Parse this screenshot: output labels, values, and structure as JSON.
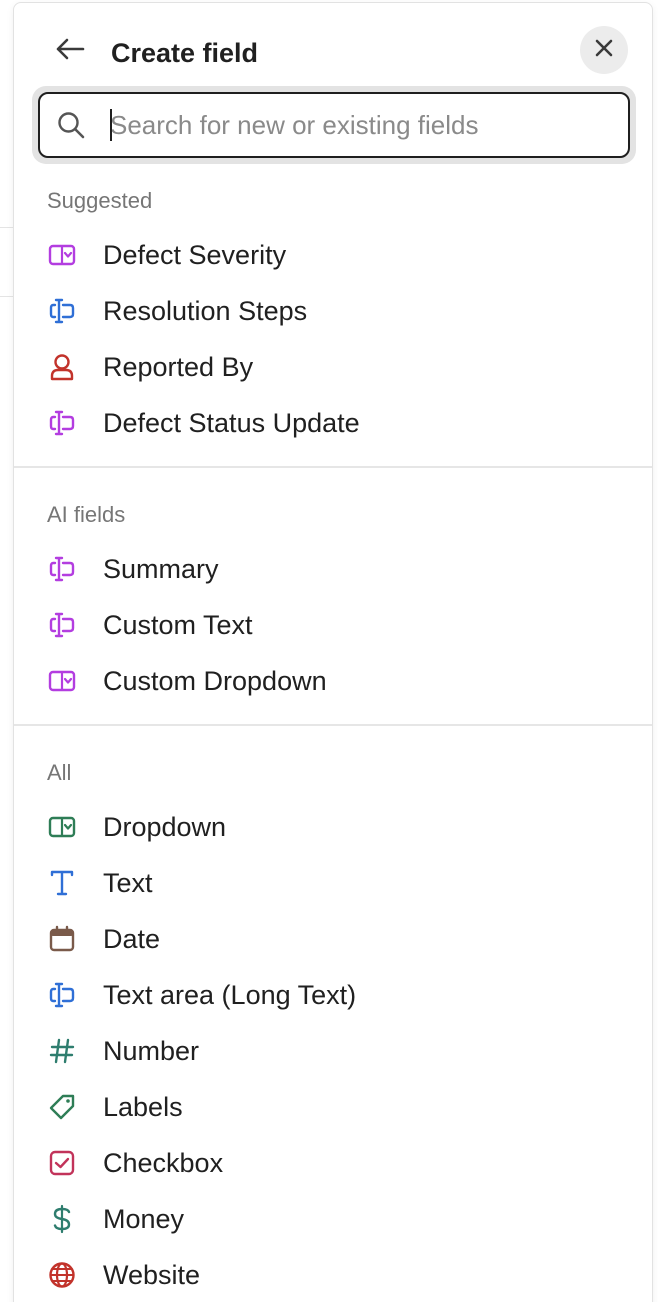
{
  "header": {
    "title": "Create field"
  },
  "search": {
    "placeholder": "Search for new or existing fields",
    "value": ""
  },
  "sections": {
    "suggested": {
      "label": "Suggested",
      "items": [
        {
          "label": "Defect Severity",
          "icon": "dropdown-icon",
          "color": "#b33de0"
        },
        {
          "label": "Resolution Steps",
          "icon": "text-area-icon",
          "color": "#2f6fd6"
        },
        {
          "label": "Reported By",
          "icon": "person-icon",
          "color": "#c2332b"
        },
        {
          "label": "Defect Status Update",
          "icon": "text-area-icon",
          "color": "#b33de0"
        }
      ]
    },
    "ai_fields": {
      "label": "AI fields",
      "items": [
        {
          "label": "Summary",
          "icon": "text-area-icon",
          "color": "#b33de0"
        },
        {
          "label": "Custom Text",
          "icon": "text-area-icon",
          "color": "#b33de0"
        },
        {
          "label": "Custom Dropdown",
          "icon": "dropdown-icon",
          "color": "#b33de0"
        }
      ]
    },
    "all": {
      "label": "All",
      "items": [
        {
          "label": "Dropdown",
          "icon": "dropdown-icon",
          "color": "#2e7d56"
        },
        {
          "label": "Text",
          "icon": "text-icon",
          "color": "#2f6fd6"
        },
        {
          "label": "Date",
          "icon": "calendar-icon",
          "color": "#7a5a4a"
        },
        {
          "label": "Text area (Long Text)",
          "icon": "text-area-icon",
          "color": "#2f6fd6"
        },
        {
          "label": "Number",
          "icon": "hash-icon",
          "color": "#2e7d6e"
        },
        {
          "label": "Labels",
          "icon": "tag-icon",
          "color": "#2e7d56"
        },
        {
          "label": "Checkbox",
          "icon": "checkbox-icon",
          "color": "#c2335a"
        },
        {
          "label": "Money",
          "icon": "dollar-icon",
          "color": "#2e7d6e"
        },
        {
          "label": "Website",
          "icon": "globe-icon",
          "color": "#c2332b"
        }
      ]
    }
  }
}
